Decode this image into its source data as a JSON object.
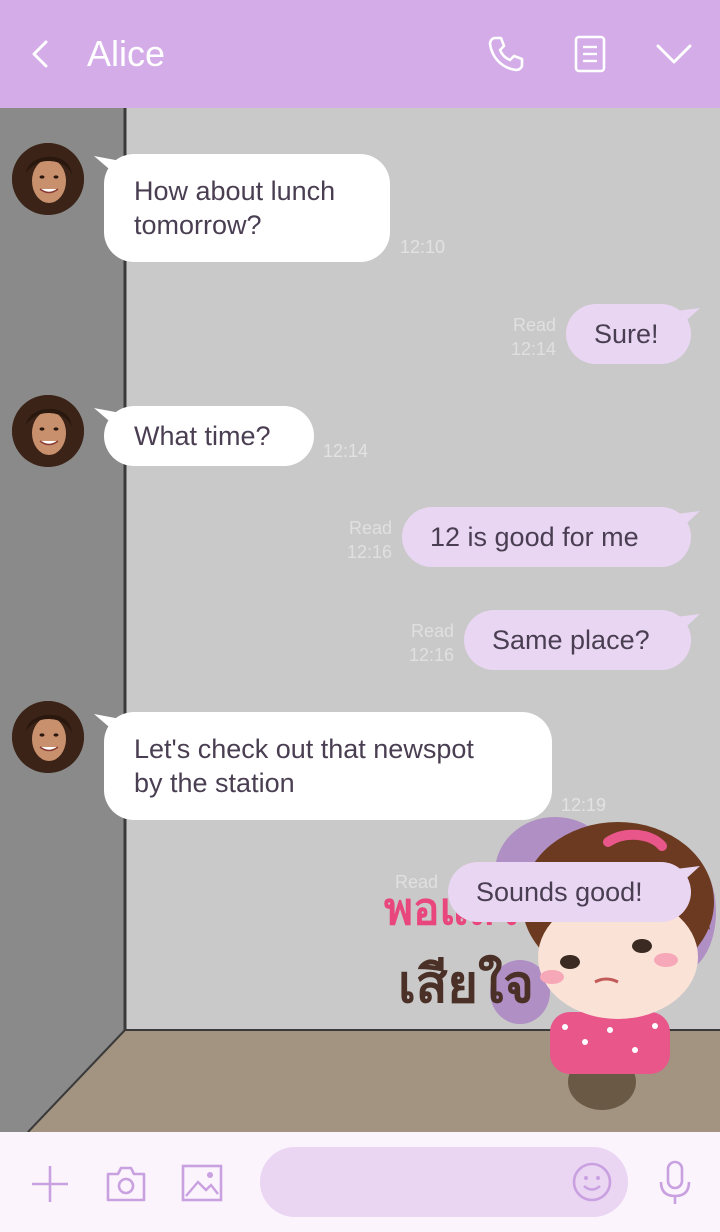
{
  "header": {
    "title": "Alice",
    "icons": {
      "back": "chevron-left-icon",
      "call": "phone-icon",
      "memo": "memo-icon",
      "more": "chevron-down-icon"
    }
  },
  "colors": {
    "header": "#d3ace8",
    "outgoing_bubble": "#e9d6f2",
    "incoming_bubble": "#ffffff",
    "accent": "#c9a0e0"
  },
  "messages": [
    {
      "direction": "in",
      "text_lines": [
        "How about lunch",
        "tomorrow?"
      ],
      "time": "12:10"
    },
    {
      "direction": "out",
      "text": "Sure!",
      "read": "Read",
      "time": "12:14"
    },
    {
      "direction": "in",
      "text": "What time?",
      "time": "12:14"
    },
    {
      "direction": "out",
      "text": "12 is good for me",
      "read": "Read",
      "time": "12:16"
    },
    {
      "direction": "out",
      "text": "Same place?",
      "read": "Read",
      "time": "12:16"
    },
    {
      "direction": "in",
      "text_lines": [
        "Let's check out that newspot",
        "by the station"
      ],
      "time": "12:19"
    },
    {
      "direction": "out",
      "text": "Sounds good!",
      "read": "Read"
    }
  ],
  "sticker": {
    "thai_line1": "พอแล้ว",
    "thai_line2": "เสียใจ"
  },
  "inputbar": {
    "icons": [
      "plus-icon",
      "camera-icon",
      "image-icon",
      "smiley-icon",
      "microphone-icon"
    ]
  }
}
